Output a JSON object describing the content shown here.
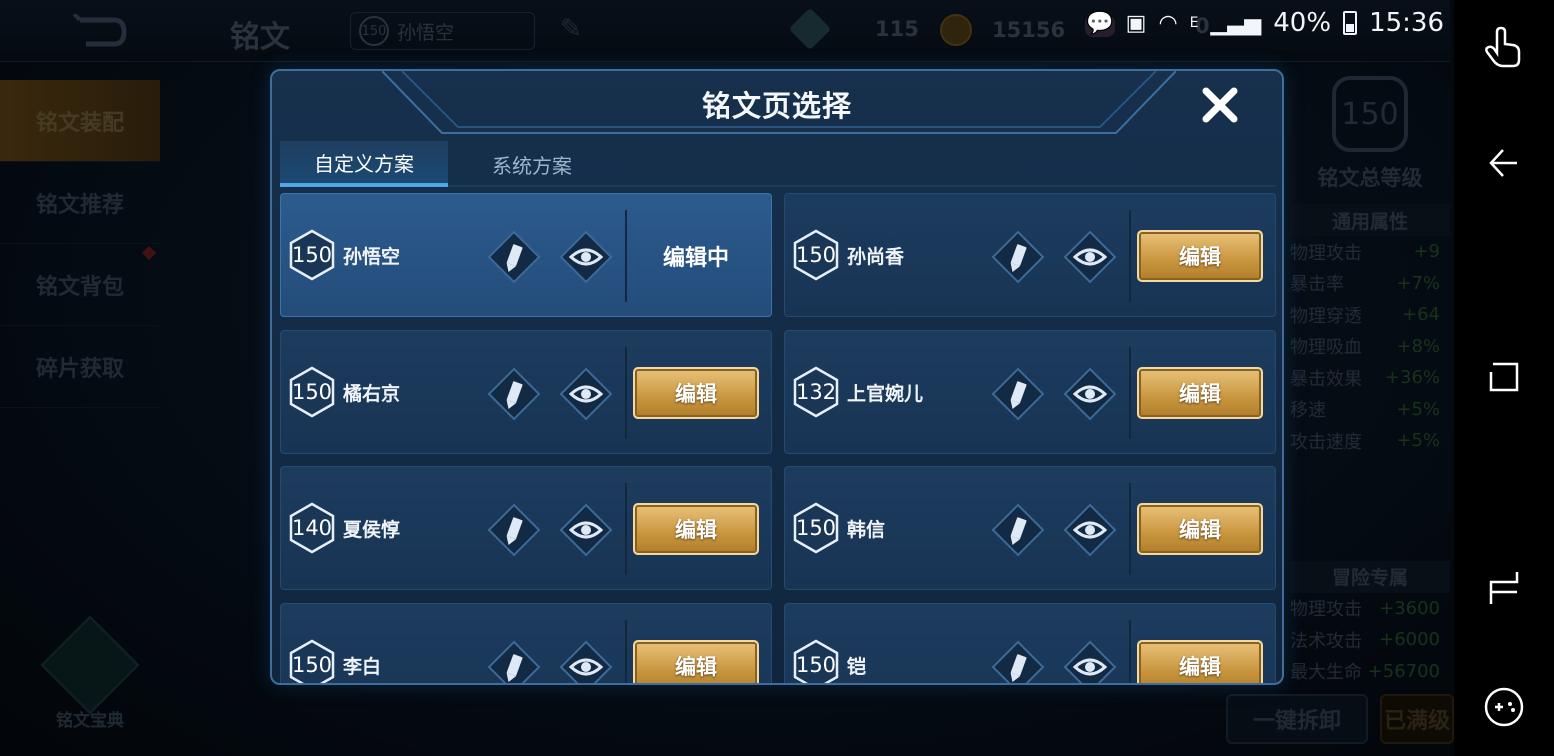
{
  "header": {
    "page_title": "铭文",
    "current_hero": {
      "level": "150",
      "name": "孙悟空"
    },
    "resources": [
      {
        "icon": "gem-icon",
        "value": "115"
      },
      {
        "icon": "gold-coin-icon",
        "value": "15156"
      },
      {
        "icon": "diamond-icon",
        "value": "0"
      }
    ]
  },
  "status_bar": {
    "battery": "40%",
    "time": "15:36"
  },
  "sidebar": {
    "items": [
      {
        "label": "铭文装配",
        "active": true
      },
      {
        "label": "铭文推荐",
        "active": false
      },
      {
        "label": "铭文背包",
        "active": false
      },
      {
        "label": "碎片获取",
        "active": false
      }
    ],
    "codex_label": "铭文宝典"
  },
  "right_panel": {
    "total_level": "150",
    "total_level_label": "铭文总等级",
    "general_title": "通用属性",
    "general": [
      {
        "name": "物理攻击",
        "value": "+9"
      },
      {
        "name": "暴击率",
        "value": "+7%"
      },
      {
        "name": "物理穿透",
        "value": "+64"
      },
      {
        "name": "物理吸血",
        "value": "+8%"
      },
      {
        "name": "暴击效果",
        "value": "+36%"
      },
      {
        "name": "移速",
        "value": "+5%"
      },
      {
        "name": "攻击速度",
        "value": "+5%"
      }
    ],
    "adventure_title": "冒险专属",
    "adventure": [
      {
        "name": "物理攻击",
        "value": "+3600"
      },
      {
        "name": "法术攻击",
        "value": "+6000"
      },
      {
        "name": "最大生命",
        "value": "+56700"
      }
    ],
    "unload_all": "一键拆卸",
    "maxed": "已满级"
  },
  "modal": {
    "title": "铭文页选择",
    "tabs": [
      {
        "label": "自定义方案",
        "active": true
      },
      {
        "label": "系统方案",
        "active": false
      }
    ],
    "edit_label": "编辑",
    "editing_label": "编辑中",
    "pages": [
      {
        "level": "150",
        "name": "孙悟空",
        "current": true
      },
      {
        "level": "150",
        "name": "孙尚香",
        "current": false
      },
      {
        "level": "150",
        "name": "橘右京",
        "current": false
      },
      {
        "level": "132",
        "name": "上官婉儿",
        "current": false
      },
      {
        "level": "140",
        "name": "夏侯惇",
        "current": false
      },
      {
        "level": "150",
        "name": "韩信",
        "current": false
      },
      {
        "level": "150",
        "name": "李白",
        "current": false
      },
      {
        "level": "150",
        "name": "铠",
        "current": false
      }
    ]
  },
  "colors": {
    "modal_bg": "#16304d",
    "modal_border": "#3d6e9e",
    "edit_gold": "#c9963f",
    "active_tab_underline": "#4fa6e8"
  }
}
